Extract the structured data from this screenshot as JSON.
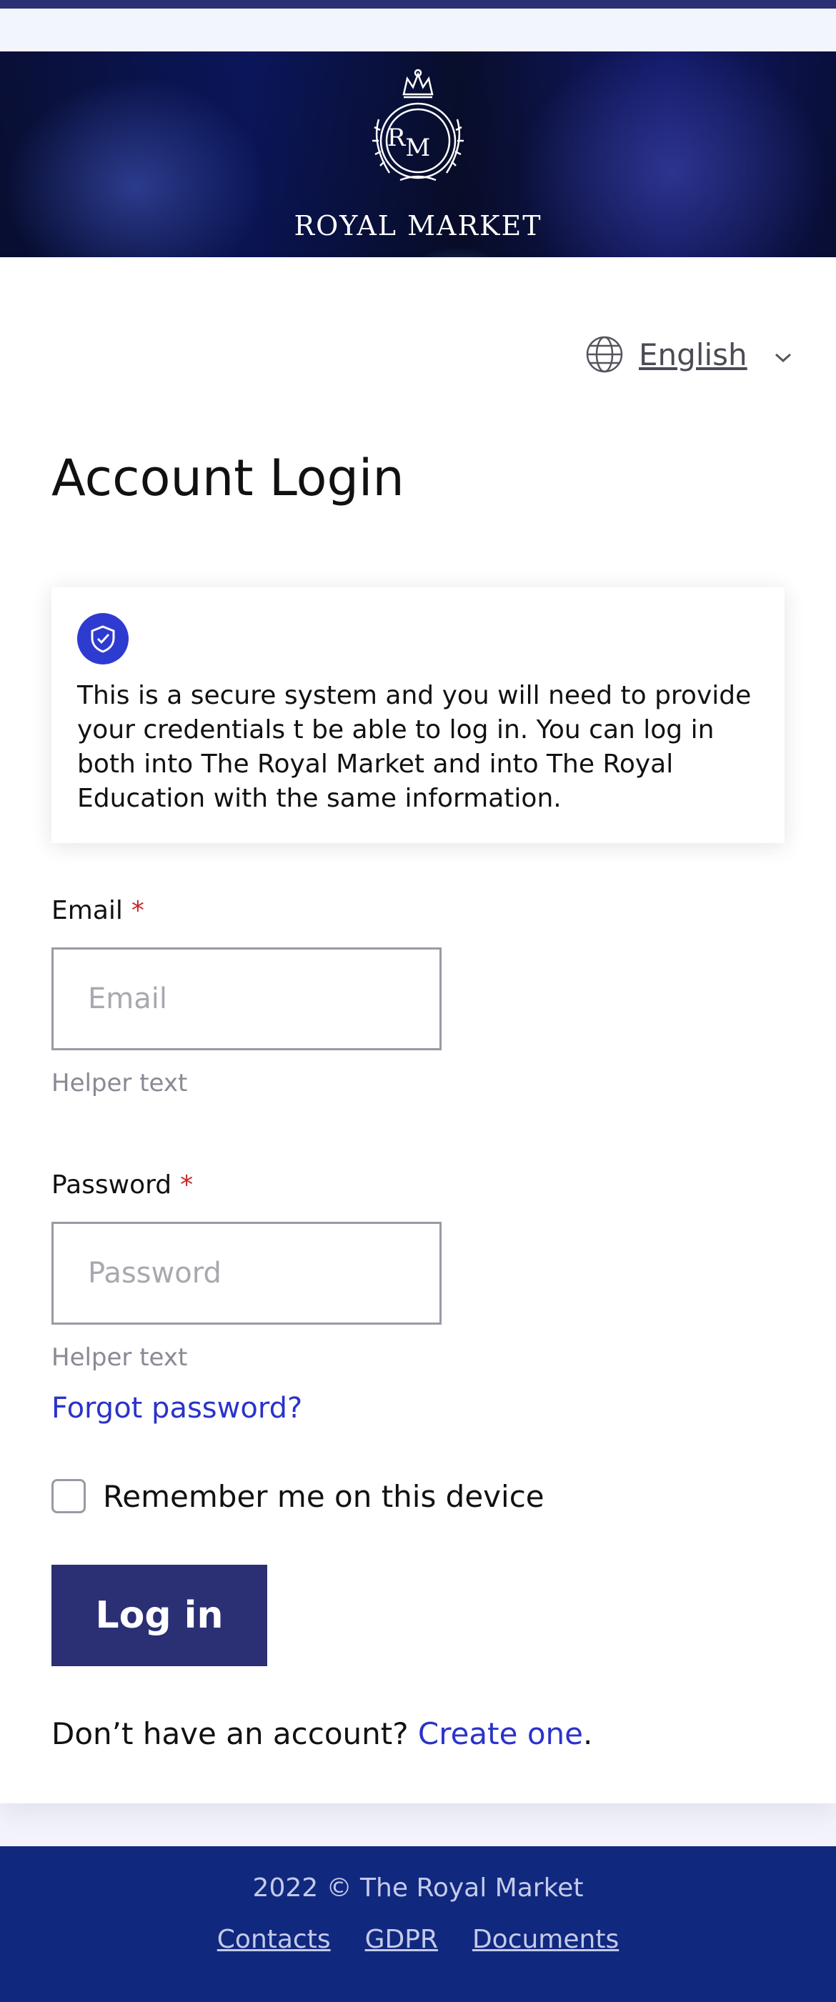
{
  "brand": {
    "name": "ROYAL MARKET",
    "monogram": "RM"
  },
  "language": {
    "label": "English",
    "icon": "globe-icon"
  },
  "page": {
    "title": "Account Login"
  },
  "notice": {
    "icon": "shield-check-icon",
    "text": "This is a secure system and you will need to provide your credentials t be able to log in. You can log in both into The Royal Market and into The Royal Education with the same information."
  },
  "email": {
    "label": "Email",
    "required_mark": "*",
    "placeholder": "Email",
    "value": "",
    "helper": "Helper text"
  },
  "password": {
    "label": "Password",
    "required_mark": "*",
    "placeholder": "Password",
    "value": "",
    "helper": "Helper text"
  },
  "forgot_password": "Forgot password?",
  "remember_me": {
    "label": "Remember me on this device",
    "checked": false
  },
  "login_button": "Log in",
  "signup": {
    "prompt": "Don’t have an account? ",
    "link": "Create one",
    "suffix": "."
  },
  "footer": {
    "copyright": "2022 © The Royal Market",
    "links": [
      "Contacts",
      "GDPR",
      "Documents"
    ]
  },
  "colors": {
    "accent": "#2a33c9",
    "button": "#2b3075",
    "footer": "#11287f",
    "required": "#c62828"
  }
}
